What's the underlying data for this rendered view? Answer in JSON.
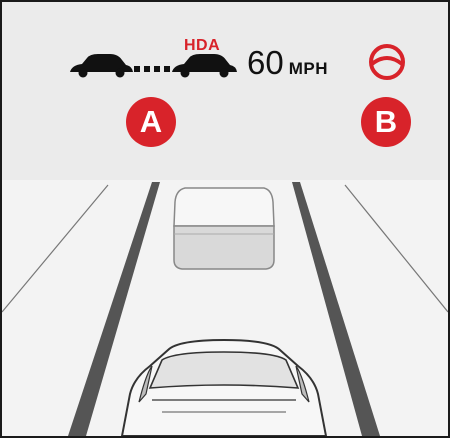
{
  "hud": {
    "hda_label": "HDA",
    "speed_value": "60",
    "speed_unit": "MPH"
  },
  "callouts": {
    "a": "A",
    "b": "B"
  },
  "icons": {
    "lead_car": "lead-vehicle-icon",
    "own_car": "own-vehicle-icon",
    "distance": "following-distance-dots-icon",
    "steering": "steering-wheel-icon"
  },
  "colors": {
    "accent_red": "#d8232a",
    "icon_black": "#111111",
    "hud_background": "#ebebeb",
    "road": "#f2f2f2",
    "lane_line": "#555555"
  }
}
